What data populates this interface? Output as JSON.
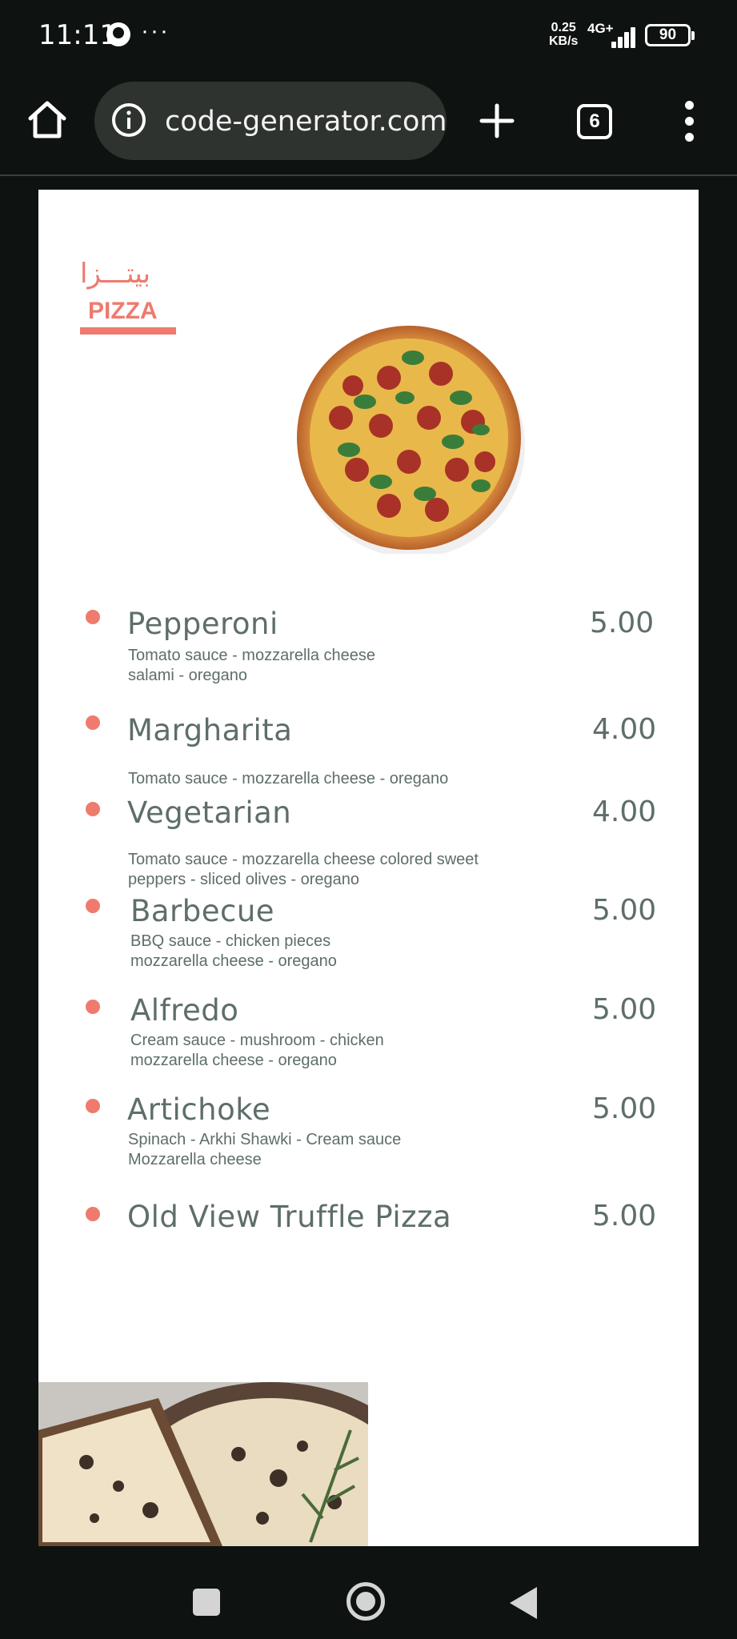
{
  "status_bar": {
    "time": "11:11",
    "more": "···",
    "net_speed_value": "0.25",
    "net_speed_unit": "KB/s",
    "net_type": "4G+",
    "battery": "90"
  },
  "browser": {
    "url": "code-generator.com",
    "tab_count": "6"
  },
  "page": {
    "title_ar": "بيتـــزا",
    "title_en": "PIZZA",
    "accent_color": "#ef7a6e",
    "text_color": "#5e6e68",
    "menu_items": [
      {
        "name": "Pepperoni",
        "description": "Tomato sauce - mozzarella cheese\nsalami - oregano",
        "price": "5.00"
      },
      {
        "name": "Margharita",
        "description": "Tomato sauce - mozzarella cheese - oregano",
        "price": "4.00"
      },
      {
        "name": "Vegetarian",
        "description": "Tomato sauce - mozzarella cheese colored sweet\npeppers - sliced olives - oregano",
        "price": "4.00"
      },
      {
        "name": "Barbecue",
        "description": "BBQ sauce - chicken pieces\nmozzarella cheese - oregano",
        "price": "5.00"
      },
      {
        "name": "Alfredo",
        "description": "Cream sauce - mushroom - chicken\nmozzarella cheese - oregano",
        "price": "5.00"
      },
      {
        "name": "Artichoke",
        "description": "Spinach - Arkhi Shawki - Cream sauce\nMozzarella cheese",
        "price": "5.00"
      },
      {
        "name": "Old View Truffle Pizza",
        "description": "",
        "price": "5.00"
      }
    ]
  }
}
